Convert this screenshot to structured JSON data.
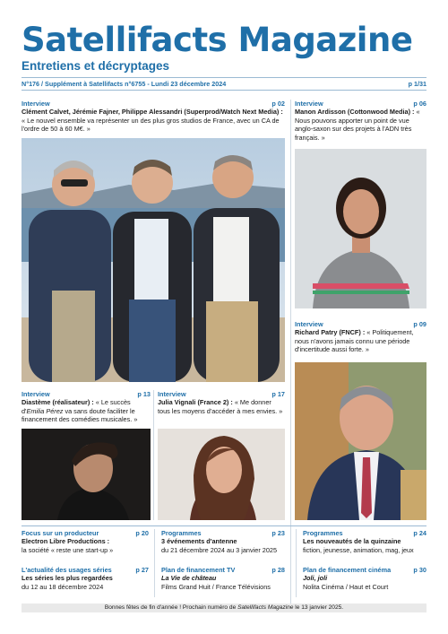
{
  "masthead": {
    "title": "Satellifacts Magazine",
    "subtitle": "Entretiens et décryptages"
  },
  "issue": {
    "left": "N°176 / Supplément à Satellifacts n°6755 - Lundi 23 décembre 2024",
    "right": "p 1/31"
  },
  "articles": {
    "superprod": {
      "kicker": "Interview",
      "page": "p 02",
      "names": "Clément Calvet, Jérémie Fajner, Philippe Alessandri (Superprod/Watch Next Media) :",
      "quote": " « Le nouvel ensemble va représenter un des plus gros studios de France, avec un CA de l'ordre de 50 à 60 M€. »"
    },
    "ardisson": {
      "kicker": "Interview",
      "page": "p 06",
      "names": "Manon Ardisson (Cottonwood Media) :",
      "quote": " « Nous pouvons apporter un point de vue anglo-saxon sur des projets à l'ADN très français. »"
    },
    "patry": {
      "kicker": "Interview",
      "page": "p 09",
      "names": "Richard Patry (FNCF) :",
      "quote": " « Politiquement, nous n'avons jamais connu une période d'incertitude aussi forte. »"
    },
    "diasteme": {
      "kicker": "Interview",
      "page": "p 13",
      "names": "Diastème (réalisateur) :",
      "quote_a": " « Le succès d'",
      "quote_italic": "Emilia Pérez",
      "quote_b": " va sans doute faciliter le financement des comédies musicales. »"
    },
    "vignali": {
      "kicker": "Interview",
      "page": "p 17",
      "names": "Julia Vignali (France 2) :",
      "quote": " « Me donner tous les moyens d'accéder à mes envies. »"
    }
  },
  "bottom": {
    "producer": {
      "kicker": "Focus sur un producteur",
      "page": "p 20",
      "title": "Electron Libre Productions :",
      "text": "la société « reste une start-up »"
    },
    "programmes1": {
      "kicker": "Programmes",
      "page": "p 23",
      "title": "3 événements d'antenne",
      "text": "du 21 décembre 2024 au 3 janvier 2025"
    },
    "programmes2": {
      "kicker": "Programmes",
      "page": "p 24",
      "title": "Les nouveautés de la quinzaine",
      "text": "fiction, jeunesse, animation, mag, jeux"
    },
    "usages": {
      "kicker": "L'actualité des usages séries",
      "page": "p 27",
      "title": "Les séries les plus regardées",
      "text": "du 12 au 18 décembre 2024"
    },
    "financement_tv": {
      "kicker": "Plan de financement TV",
      "page": "p 28",
      "title": "La Vie de château",
      "text": "Films Grand Huit / France Télévisions"
    },
    "financement_cinema": {
      "kicker": "Plan de financement cinéma",
      "page": "p 30",
      "title": "Joli, joli",
      "text": "Nolita Cinéma / Haut et Court"
    }
  },
  "footer": {
    "text_a": "Bonnes fêtes de fin d'année ! Prochain numéro de ",
    "text_italic": "Satellifacts Magazine",
    "text_b": " le 13 janvier 2025."
  },
  "colors": {
    "brand": "#1f6fa8",
    "rule": "#9bbad3"
  }
}
